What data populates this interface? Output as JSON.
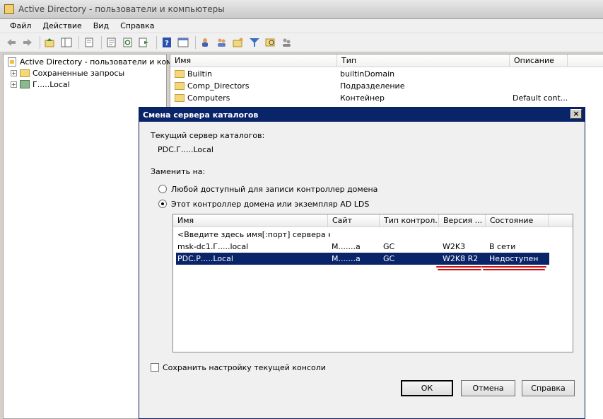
{
  "window": {
    "title": "Active Directory - пользователи и компьютеры"
  },
  "menu": {
    "items": [
      "Файл",
      "Действие",
      "Вид",
      "Справка"
    ]
  },
  "toolbar": {
    "icons": [
      "back-icon",
      "forward-icon",
      "up-icon",
      "show-tree-icon",
      "copy-icon",
      "properties-icon",
      "refresh-icon",
      "export-icon",
      "help-icon",
      "console-icon",
      "new-user-icon",
      "new-group-icon",
      "new-ou-icon",
      "filter-icon",
      "find-icon",
      "add-to-group-icon"
    ]
  },
  "tree": {
    "root": "Active Directory - пользователи и компью",
    "items": [
      {
        "label": "Сохраненные запросы"
      },
      {
        "label": "Г.....Local"
      }
    ]
  },
  "list": {
    "columns": [
      "Имя",
      "Тип",
      "Описание"
    ],
    "rows": [
      {
        "name": "Builtin",
        "type": "builtinDomain",
        "desc": ""
      },
      {
        "name": "Comp_Directors",
        "type": "Подразделение",
        "desc": ""
      },
      {
        "name": "Computers",
        "type": "Контейнер",
        "desc": "Default cont..."
      }
    ]
  },
  "dialog": {
    "title": "Смена сервера каталогов",
    "current_label": "Текущий сервер каталогов:",
    "current_value": "PDC.Г.....Local",
    "replace_label": "Заменить на:",
    "radio_any": "Любой доступный для записи контроллер домена",
    "radio_this": "Этот контроллер домена или экземпляр AD LDS",
    "columns": [
      "Имя",
      "Сайт",
      "Тип контрол...",
      "Версия ...",
      "Состояние"
    ],
    "rows": [
      {
        "name": "<Введите здесь имя[:порт] сервера кат...",
        "site": "",
        "type": "",
        "version": "",
        "state": ""
      },
      {
        "name": "msk-dc1.Г.....local",
        "site": "М.......а",
        "type": "GC",
        "version": "W2K3",
        "state": "В сети"
      },
      {
        "name": "PDC.Р.....Local",
        "site": "М.......а",
        "type": "GC",
        "version": "W2K8 R2",
        "state": "Недоступен"
      }
    ],
    "save_setting": "Сохранить настройку текущей консоли",
    "ok": "ОК",
    "cancel": "Отмена",
    "help": "Справка"
  }
}
